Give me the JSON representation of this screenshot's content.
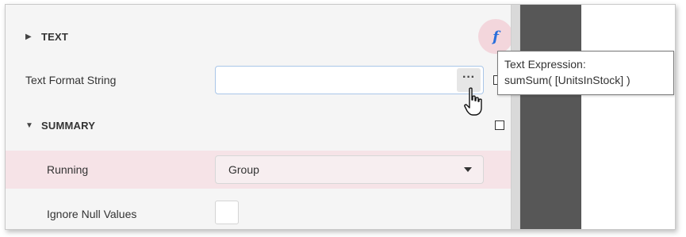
{
  "sections": {
    "text": {
      "title": "TEXT",
      "collapsed": true
    },
    "summary": {
      "title": "SUMMARY",
      "collapsed": false
    }
  },
  "fields": {
    "text_format_string": {
      "label": "Text Format String",
      "value": ""
    },
    "running": {
      "label": "Running",
      "value": "Group"
    },
    "ignore_null_values": {
      "label": "Ignore Null Values",
      "checked": false
    }
  },
  "buttons": {
    "ellipsis": "···",
    "fx": "f"
  },
  "tooltip": {
    "line1": "Text Expression:",
    "line2": "sumSum( [UnitsInStock] )"
  },
  "icons": {
    "expand": "right-triangle-icon",
    "collapse": "down-triangle-icon",
    "tree": "hierarchy-icon",
    "cursor": "hand-pointer-icon"
  },
  "colors": {
    "highlight_row": "#f6e3e7",
    "fx_circle": "#f3d6dc",
    "fx_glyph": "#2a6fdb",
    "input_border": "#a9c6e8",
    "dark_strip": "#575757"
  }
}
